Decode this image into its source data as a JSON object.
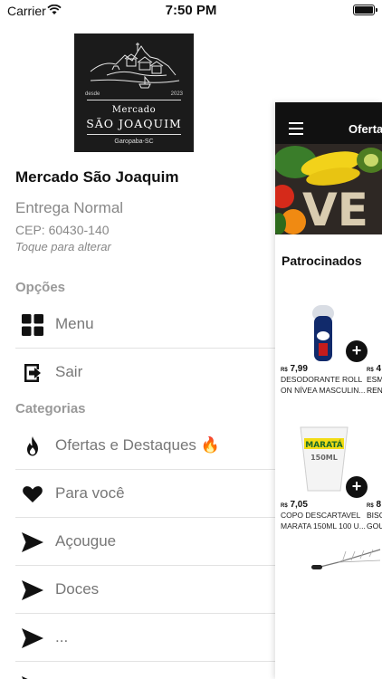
{
  "status_bar": {
    "carrier": "Carrier",
    "time": "7:50 PM"
  },
  "logo": {
    "since": "desde",
    "year": "2023",
    "name_line1": "Mercado",
    "name_line2": "SÃO JOAQUIM",
    "city": "Garopaba-SC"
  },
  "store": {
    "name": "Mercado São Joaquim",
    "delivery_mode": "Entrega Normal",
    "cep": "CEP: 60430-140",
    "change_hint": "Toque para alterar"
  },
  "options": {
    "title": "Opções",
    "items": [
      {
        "label": "Menu",
        "icon": "grid-icon"
      },
      {
        "label": "Sair",
        "icon": "exit-icon"
      }
    ]
  },
  "categories": {
    "title": "Categorias",
    "items": [
      {
        "label": "Ofertas e Destaques 🔥",
        "icon": "fire-icon"
      },
      {
        "label": "Para você",
        "icon": "heart-icon"
      },
      {
        "label": "Açougue",
        "icon": "send-icon"
      },
      {
        "label": "Doces",
        "icon": "send-icon"
      },
      {
        "label": "...",
        "icon": "send-icon"
      }
    ]
  },
  "main_panel": {
    "nav_title": "Ofertas",
    "section_title": "Patrocinados",
    "products": [
      {
        "currency": "R$",
        "price": "7,99",
        "desc_line1": "DESODORANTE ROLL",
        "desc_line2": "ON NÍVEA MASCULIN..."
      },
      {
        "currency": "R$",
        "price": "7,05",
        "desc_line1": "COPO DESCARTAVEL",
        "desc_line2": "MARATA 150ML 100 U..."
      }
    ],
    "partial_products": [
      {
        "currency": "R$",
        "price": "4",
        "desc_line1": "ESM",
        "desc_line2": "REN"
      },
      {
        "currency": "R$",
        "price": "8",
        "desc_line1": "BISC",
        "desc_line2": "GOU"
      }
    ],
    "cup_brand": "MARATÁ",
    "cup_size": "150ML",
    "banner_text": "VE"
  }
}
